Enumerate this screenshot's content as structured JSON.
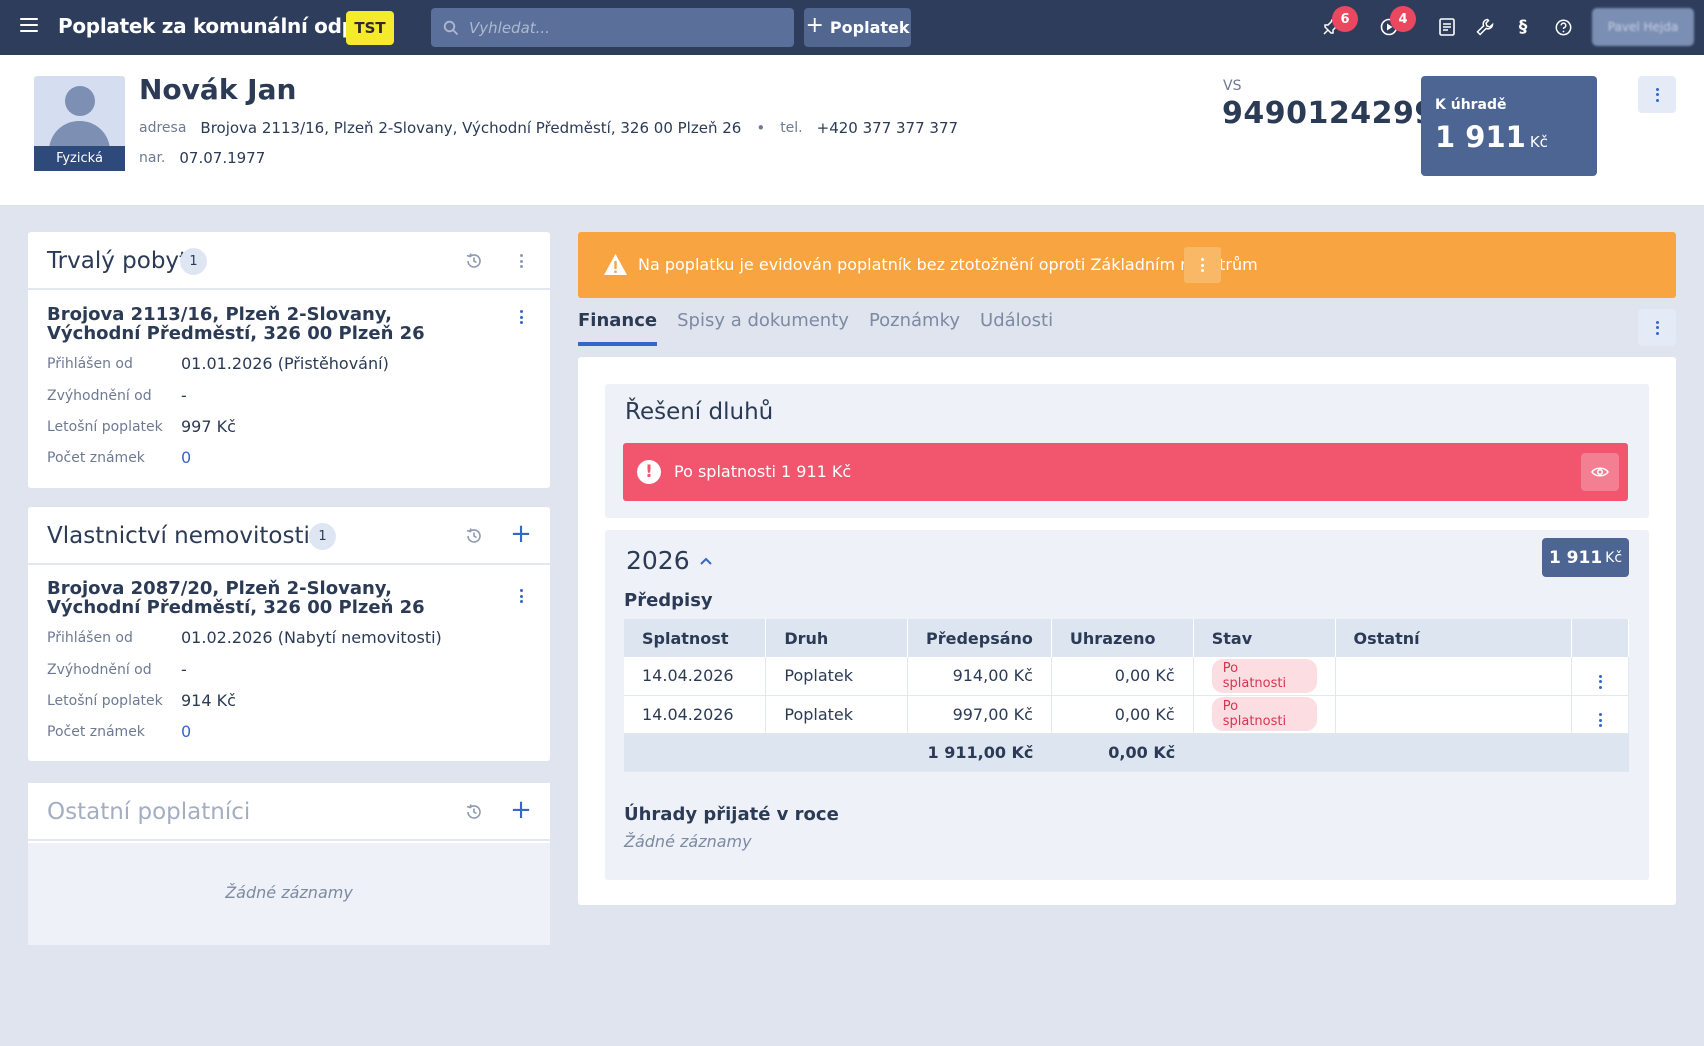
{
  "topbar": {
    "title": "Poplatek za komunální odpad",
    "env_badge": "TST",
    "search_placeholder": "Vyhledat...",
    "add_button_label": "Poplatek",
    "pin_count": "6",
    "play_count": "4",
    "paragraph_icon": "§",
    "user_name": "Pavel Hejda"
  },
  "person": {
    "name": "Novák Jan",
    "type_label": "Fyzická",
    "address_label": "adresa",
    "address": "Brojova 2113/16, Plzeň 2-Slovany, Východní Předměstí, 326 00 Plzeň 26",
    "phone_label": "tel.",
    "phone": "+420 377 377 377",
    "birth_label": "nar.",
    "birth_date": "07.07.1977",
    "vs_label": "VS",
    "vs_value": "9490124299",
    "due_label": "K úhradě",
    "due_value": "1 911",
    "due_currency": "Kč"
  },
  "panels": {
    "permanent_residence": {
      "title": "Trvalý pobyt",
      "count": "1",
      "address": "Brojova 2113/16, Plzeň 2-Slovany, Východní Předměstí, 326 00 Plzeň 26",
      "rows": [
        {
          "label": "Přihlášen od",
          "value": "01.01.2026 (Přistěhování)"
        },
        {
          "label": "Zvýhodnění od",
          "value": "-"
        },
        {
          "label": "Letošní poplatek",
          "value": "997 Kč"
        },
        {
          "label": "Počet známek",
          "value": "0"
        }
      ]
    },
    "property": {
      "title": "Vlastnictví nemovitosti",
      "count": "1",
      "address": "Brojova 2087/20, Plzeň 2-Slovany, Východní Předměstí, 326 00 Plzeň 26",
      "rows": [
        {
          "label": "Přihlášen od",
          "value": "01.02.2026 (Nabytí nemovitosti)"
        },
        {
          "label": "Zvýhodnění od",
          "value": "-"
        },
        {
          "label": "Letošní poplatek",
          "value": "914 Kč"
        },
        {
          "label": "Počet známek",
          "value": "0"
        }
      ]
    },
    "other_payers": {
      "title": "Ostatní poplatníci",
      "empty": "Žádné záznamy"
    }
  },
  "warning": {
    "message": "Na poplatku je evidován poplatník bez ztotožnění oproti Základním registrům"
  },
  "tabs": [
    "Finance",
    "Spisy a dokumenty",
    "Poznámky",
    "Události"
  ],
  "finance": {
    "debt_title": "Řešení dluhů",
    "overdue_alert": "Po splatnosti 1 911 Kč",
    "year": "2026",
    "year_sum": "1 911",
    "year_sum_currency": "Kč",
    "prescriptions_title": "Předpisy",
    "columns": [
      "Splatnost",
      "Druh",
      "Předepsáno",
      "Uhrazeno",
      "Stav",
      "Ostatní"
    ],
    "rows": [
      {
        "due": "14.04.2026",
        "kind": "Poplatek",
        "prescribed": "914,00 Kč",
        "paid": "0,00 Kč",
        "status": "Po splatnosti",
        "other": ""
      },
      {
        "due": "14.04.2026",
        "kind": "Poplatek",
        "prescribed": "997,00 Kč",
        "paid": "0,00 Kč",
        "status": "Po splatnosti",
        "other": ""
      }
    ],
    "total_prescribed": "1 911,00 Kč",
    "total_paid": "0,00 Kč",
    "payments_title": "Úhrady přijaté v roce",
    "payments_empty": "Žádné záznamy"
  },
  "colors": {
    "topbar": "#2e3d5c",
    "accent": "#3566c9",
    "warning": "#f8a541",
    "danger": "#f2566f",
    "env_badge": "#f6ea2c"
  }
}
